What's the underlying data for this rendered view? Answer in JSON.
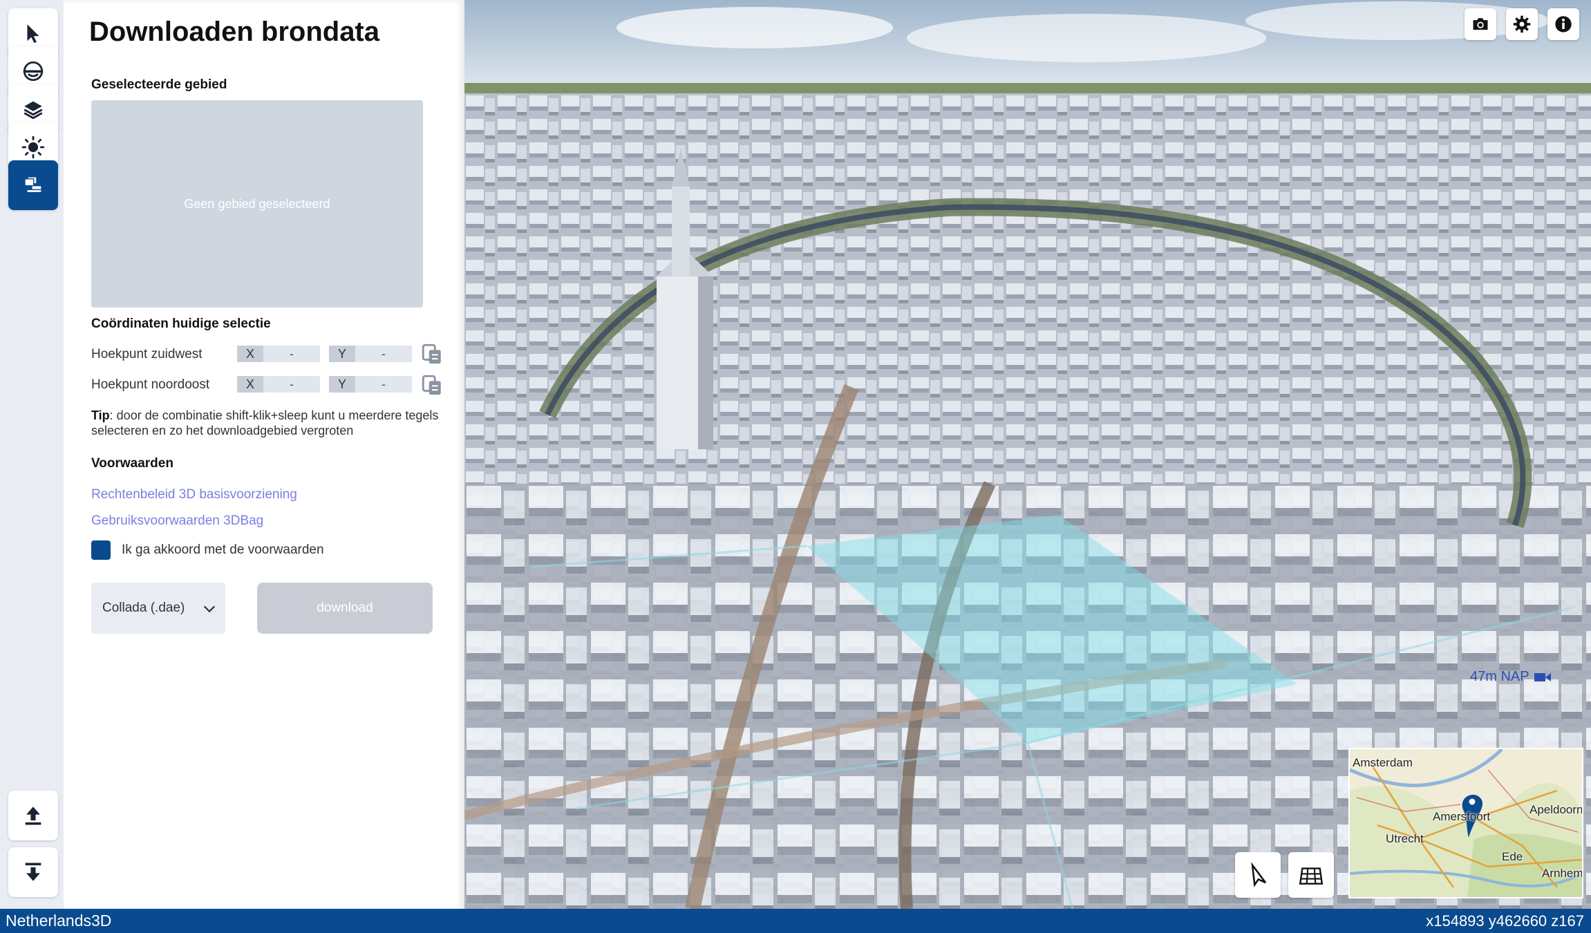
{
  "panel": {
    "title": "Downloaden brondata",
    "selected_area_heading": "Geselecteerde gebied",
    "area_placeholder": "Geen gebied geselecteerd",
    "coords_heading": "Coördinaten huidige selectie",
    "corners": [
      {
        "label": "Hoekpunt zuidwest",
        "x_axis": "X",
        "x_value": "-",
        "y_axis": "Y",
        "y_value": "-"
      },
      {
        "label": "Hoekpunt noordoost",
        "x_axis": "X",
        "x_value": "-",
        "y_axis": "Y",
        "y_value": "-"
      }
    ],
    "tip_bold": "Tip",
    "tip_text": ": door de combinatie shift-klik+sleep kunt u meerdere tegels selecteren en zo het downloadgebied vergroten",
    "conditions_heading": "Voorwaarden",
    "links": [
      "Rechtenbeleid 3D basisvoorziening",
      "Gebruiksvoorwaarden 3DBag"
    ],
    "agree_label": "Ik ga akkoord met de voorwaarden",
    "agree_checked": true,
    "format_selected": "Collada (.dae)",
    "download_label": "download"
  },
  "toolbar": {
    "tools": [
      "select-tool",
      "underground-tool",
      "layers-tool",
      "sun-tool",
      "download-tool"
    ],
    "active_tool": "download-tool",
    "bottom_tools": [
      "upload-tool",
      "import-tool"
    ]
  },
  "viewport": {
    "top_buttons": [
      "camera-icon",
      "gear-icon",
      "info-icon"
    ],
    "nap_readout": "47m NAP",
    "bottom_buttons": [
      "pointer-icon",
      "grid-icon"
    ],
    "minimap_labels": [
      "Amsterdam",
      "Amersfoort",
      "Apeldoorn",
      "Utrecht",
      "Ede",
      "Arnhem"
    ]
  },
  "statusbar": {
    "app_name": "Netherlands3D",
    "coordinates": "x154893 y462660 z167"
  },
  "colors": {
    "accent": "#0a4a8e",
    "link": "#7c7ee2",
    "selection": "#7fe0e8"
  }
}
